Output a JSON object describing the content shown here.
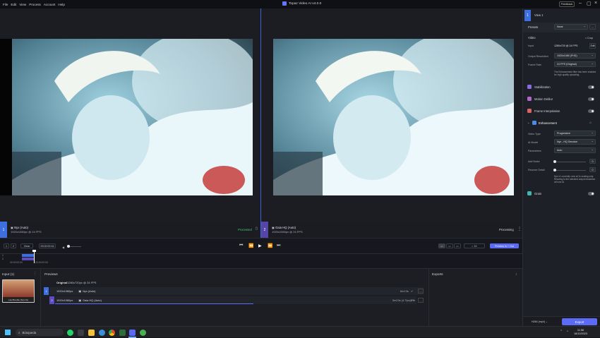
{
  "menu": [
    "File",
    "Edit",
    "View",
    "Process",
    "Account",
    "Help"
  ],
  "app_title": "Topaz Video AI v4.0.0",
  "feedback_label": "Feedback",
  "panes": [
    {
      "num": "1",
      "title": "Nyx (Auto)",
      "sub": "1920x1080px @ 24 FPS",
      "status": "Processed"
    },
    {
      "num": "2",
      "title": "Gaia HQ (Auto)",
      "sub": "1920x1080px @ 24 FPS",
      "status": "Processing"
    }
  ],
  "timeline": {
    "btn1": "1",
    "btn2": "2",
    "clear_label": "Clear",
    "timecode": "00:00:00:16",
    "in_time": "00:00:00:00",
    "out_time": "00:00:00:00",
    "zoom": "1X",
    "preview_btn": "Preview In + Out"
  },
  "bottom": {
    "input_title": "Input (1)",
    "thumb_label": "Last Boodle (S)(.mlv)",
    "previews_title": "Previews",
    "original_label": "Original",
    "original_meta": "1280x720px @ 24 FPS",
    "rows": [
      {
        "res": "1920x1080px",
        "model": "Nyx (Auto)",
        "rate": "6m13s",
        "pct": ""
      },
      {
        "res": "1920x1080px",
        "model": "Gaia HQ (Auto)",
        "rate": "5m23s (4.7fps)",
        "pct": "0%"
      }
    ],
    "exports_title": "Exports"
  },
  "sidebar": {
    "view_label": "View 1",
    "presets_label": "Presets",
    "presets_value": "None",
    "video_label": "Video",
    "crop_label": "Crop",
    "input_label": "Input",
    "input_value": "1280x720 @ 24 FPS",
    "edit_label": "Edit",
    "output_res_label": "Output Resolution",
    "output_res_value": "1920x1080 (FHD)",
    "frame_rate_label": "Frame Rate",
    "frame_rate_value": "24 FPS (Original)",
    "enh_note": "The Enhancement filter has been enabled for high-quality upscaling.",
    "stabilization": "Stabilization",
    "motion_deblur": "Motion Deblur",
    "frame_interp": "Frame Interpolation",
    "enhancement": "Enhancement",
    "video_type_label": "Video Type",
    "video_type_value": "Progressive",
    "ai_model_label": "AI Model",
    "ai_model_value": "Nyx - HQ Denoise",
    "parameters_label": "Parameters",
    "parameters_value": "Auto",
    "add_noise_label": "Add Noise",
    "add_noise_value": "0",
    "recover_label": "Recover Detail",
    "recover_value": "0",
    "nyx_note": "Nyx v1 currently runs at 1x scaling only. Resizing to the selected output resolution will use AI.",
    "grain": "Grain",
    "codec_value": "H264 (mp4)",
    "export_label": "Export"
  },
  "taskbar": {
    "search_placeholder": "Búsqueda",
    "time": "11:56",
    "date": "18/10/2023"
  }
}
